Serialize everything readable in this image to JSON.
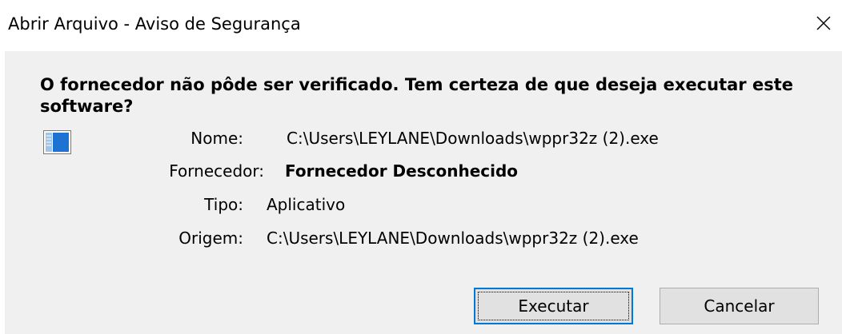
{
  "window": {
    "title": "Abrir Arquivo - Aviso de Segurança"
  },
  "dialog": {
    "heading": "O fornecedor não pôde ser verificado. Tem certeza de que deseja executar este software?",
    "fields": {
      "name_label": "Nome:",
      "name_value": "C:\\Users\\LEYLANE\\Downloads\\wppr32z (2).exe",
      "publisher_label": "Fornecedor:",
      "publisher_value": "Fornecedor Desconhecido",
      "type_label": "Tipo:",
      "type_value": "Aplicativo",
      "origin_label": "Origem:",
      "origin_value": "C:\\Users\\LEYLANE\\Downloads\\wppr32z (2).exe"
    },
    "buttons": {
      "run_label": "Executar",
      "cancel_label": "Cancelar"
    },
    "icon": "application-window-icon"
  },
  "colors": {
    "body_background": "#f0f0f0",
    "titlebar_background": "#ffffff",
    "button_background": "#e1e1e1",
    "default_button_border": "#0078d7",
    "icon_blue": "#1e73d2"
  }
}
